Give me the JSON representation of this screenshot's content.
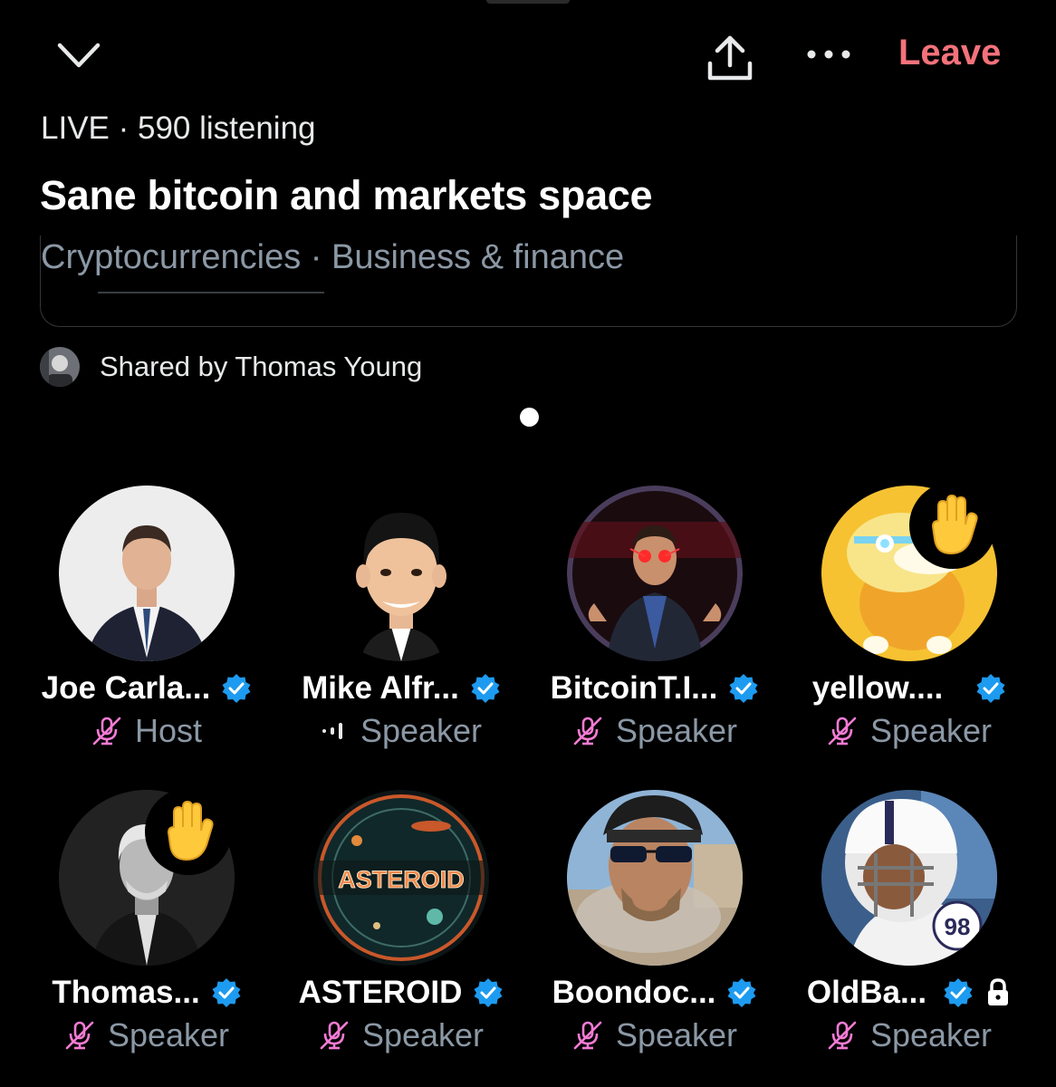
{
  "header": {
    "leave_label": "Leave"
  },
  "space": {
    "status": "LIVE · 590 listening",
    "title": "Sane bitcoin and markets space",
    "topics": "Cryptocurrencies · Business & finance",
    "shared_by": "Shared by Thomas Young"
  },
  "colors": {
    "accent_leave": "#f4727b",
    "verified": "#1d9bf0",
    "muted_mic": "#f47bd4",
    "secondary_text": "#8b98a5"
  },
  "participants": [
    {
      "name": "Joe Carla...",
      "role": "Host",
      "mic": "muted",
      "verified": true,
      "hand_raised": false
    },
    {
      "name": "Mike Alfr...",
      "role": "Speaker",
      "mic": "talking",
      "verified": true,
      "hand_raised": false
    },
    {
      "name": "BitcoinT.I...",
      "role": "Speaker",
      "mic": "muted",
      "verified": true,
      "hand_raised": false
    },
    {
      "name": "yellow....",
      "role": "Speaker",
      "mic": "muted",
      "verified": true,
      "hand_raised": true
    },
    {
      "name": "Thomas...",
      "role": "Speaker",
      "mic": "muted",
      "verified": true,
      "hand_raised": true
    },
    {
      "name": "ASTEROID",
      "role": "Speaker",
      "mic": "muted",
      "verified": true,
      "hand_raised": false,
      "avatar_text": "ASTEROID"
    },
    {
      "name": "Boondoc...",
      "role": "Speaker",
      "mic": "muted",
      "verified": true,
      "hand_raised": false
    },
    {
      "name": "OldBa...",
      "role": "Speaker",
      "mic": "muted",
      "verified": true,
      "hand_raised": false,
      "protected": true
    }
  ],
  "icons": {
    "collapse": "chevron-down-icon",
    "share": "share-upload-icon",
    "more": "more-dots-icon",
    "verified": "verified-badge-icon",
    "muted": "mic-muted-icon",
    "talking": "sound-wave-icon",
    "raised_hand": "raised-hand-icon",
    "lock": "lock-icon"
  }
}
